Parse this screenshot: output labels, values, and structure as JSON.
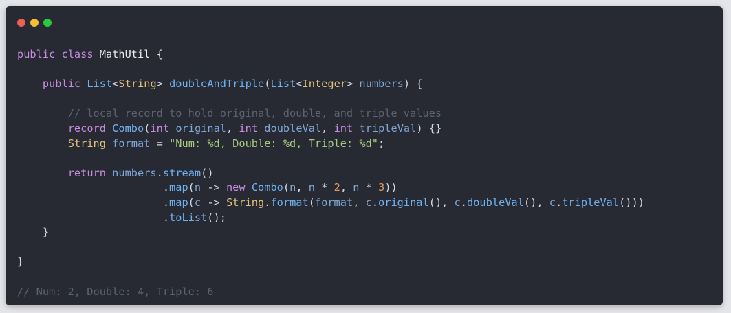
{
  "window": {
    "controls": [
      {
        "name": "close",
        "color": "#ef5f57"
      },
      {
        "name": "minimize",
        "color": "#f5bd30"
      },
      {
        "name": "maximize",
        "color": "#2bc93f"
      }
    ]
  },
  "code": {
    "language": "java",
    "lines": [
      [
        {
          "t": "public",
          "c": "kw"
        },
        {
          "t": " ",
          "c": "p"
        },
        {
          "t": "class",
          "c": "kw"
        },
        {
          "t": " MathUtil {",
          "c": "id"
        }
      ],
      [],
      [
        {
          "t": "    ",
          "c": "p"
        },
        {
          "t": "public",
          "c": "kw"
        },
        {
          "t": " ",
          "c": "p"
        },
        {
          "t": "List",
          "c": "fn"
        },
        {
          "t": "<",
          "c": "p"
        },
        {
          "t": "String",
          "c": "ty"
        },
        {
          "t": "> ",
          "c": "p"
        },
        {
          "t": "doubleAndTriple",
          "c": "fn"
        },
        {
          "t": "(",
          "c": "p"
        },
        {
          "t": "List",
          "c": "fn"
        },
        {
          "t": "<",
          "c": "p"
        },
        {
          "t": "Integer",
          "c": "ty"
        },
        {
          "t": "> ",
          "c": "p"
        },
        {
          "t": "numbers",
          "c": "pr"
        },
        {
          "t": ") {",
          "c": "p"
        }
      ],
      [],
      [
        {
          "t": "        ",
          "c": "p"
        },
        {
          "t": "// local record to hold original, double, and triple values",
          "c": "cm"
        }
      ],
      [
        {
          "t": "        ",
          "c": "p"
        },
        {
          "t": "record",
          "c": "kw"
        },
        {
          "t": " ",
          "c": "p"
        },
        {
          "t": "Combo",
          "c": "fn"
        },
        {
          "t": "(",
          "c": "p"
        },
        {
          "t": "int",
          "c": "kw"
        },
        {
          "t": " ",
          "c": "p"
        },
        {
          "t": "original",
          "c": "pr"
        },
        {
          "t": ", ",
          "c": "p"
        },
        {
          "t": "int",
          "c": "kw"
        },
        {
          "t": " ",
          "c": "p"
        },
        {
          "t": "doubleVal",
          "c": "pr"
        },
        {
          "t": ", ",
          "c": "p"
        },
        {
          "t": "int",
          "c": "kw"
        },
        {
          "t": " ",
          "c": "p"
        },
        {
          "t": "tripleVal",
          "c": "pr"
        },
        {
          "t": ") {}",
          "c": "p"
        }
      ],
      [
        {
          "t": "        ",
          "c": "p"
        },
        {
          "t": "String",
          "c": "ty"
        },
        {
          "t": " ",
          "c": "p"
        },
        {
          "t": "format",
          "c": "pr"
        },
        {
          "t": " = ",
          "c": "p"
        },
        {
          "t": "\"Num: %d, Double: %d, Triple: %d\"",
          "c": "str"
        },
        {
          "t": ";",
          "c": "p"
        }
      ],
      [],
      [
        {
          "t": "        ",
          "c": "p"
        },
        {
          "t": "return",
          "c": "kw"
        },
        {
          "t": " ",
          "c": "p"
        },
        {
          "t": "numbers",
          "c": "pr"
        },
        {
          "t": ".",
          "c": "p"
        },
        {
          "t": "stream",
          "c": "fn"
        },
        {
          "t": "()",
          "c": "p"
        }
      ],
      [
        {
          "t": "                       .",
          "c": "p"
        },
        {
          "t": "map",
          "c": "fn"
        },
        {
          "t": "(",
          "c": "p"
        },
        {
          "t": "n",
          "c": "pr"
        },
        {
          "t": " -> ",
          "c": "p"
        },
        {
          "t": "new",
          "c": "kw"
        },
        {
          "t": " ",
          "c": "p"
        },
        {
          "t": "Combo",
          "c": "fn"
        },
        {
          "t": "(",
          "c": "p"
        },
        {
          "t": "n",
          "c": "pr"
        },
        {
          "t": ", ",
          "c": "p"
        },
        {
          "t": "n",
          "c": "pr"
        },
        {
          "t": " * ",
          "c": "p"
        },
        {
          "t": "2",
          "c": "num"
        },
        {
          "t": ", ",
          "c": "p"
        },
        {
          "t": "n",
          "c": "pr"
        },
        {
          "t": " * ",
          "c": "p"
        },
        {
          "t": "3",
          "c": "num"
        },
        {
          "t": "))",
          "c": "p"
        }
      ],
      [
        {
          "t": "                       .",
          "c": "p"
        },
        {
          "t": "map",
          "c": "fn"
        },
        {
          "t": "(",
          "c": "p"
        },
        {
          "t": "c",
          "c": "pr"
        },
        {
          "t": " -> ",
          "c": "p"
        },
        {
          "t": "String",
          "c": "ty"
        },
        {
          "t": ".",
          "c": "p"
        },
        {
          "t": "format",
          "c": "fn"
        },
        {
          "t": "(",
          "c": "p"
        },
        {
          "t": "format",
          "c": "pr"
        },
        {
          "t": ", ",
          "c": "p"
        },
        {
          "t": "c",
          "c": "pr"
        },
        {
          "t": ".",
          "c": "p"
        },
        {
          "t": "original",
          "c": "fn"
        },
        {
          "t": "(), ",
          "c": "p"
        },
        {
          "t": "c",
          "c": "pr"
        },
        {
          "t": ".",
          "c": "p"
        },
        {
          "t": "doubleVal",
          "c": "fn"
        },
        {
          "t": "(), ",
          "c": "p"
        },
        {
          "t": "c",
          "c": "pr"
        },
        {
          "t": ".",
          "c": "p"
        },
        {
          "t": "tripleVal",
          "c": "fn"
        },
        {
          "t": "()))",
          "c": "p"
        }
      ],
      [
        {
          "t": "                       .",
          "c": "p"
        },
        {
          "t": "toList",
          "c": "fn"
        },
        {
          "t": "();",
          "c": "p"
        }
      ],
      [
        {
          "t": "    }",
          "c": "p"
        }
      ],
      [],
      [
        {
          "t": "}",
          "c": "p"
        }
      ],
      [],
      [
        {
          "t": "// Num: 2, Double: 4, Triple: 6",
          "c": "cm"
        }
      ]
    ]
  }
}
